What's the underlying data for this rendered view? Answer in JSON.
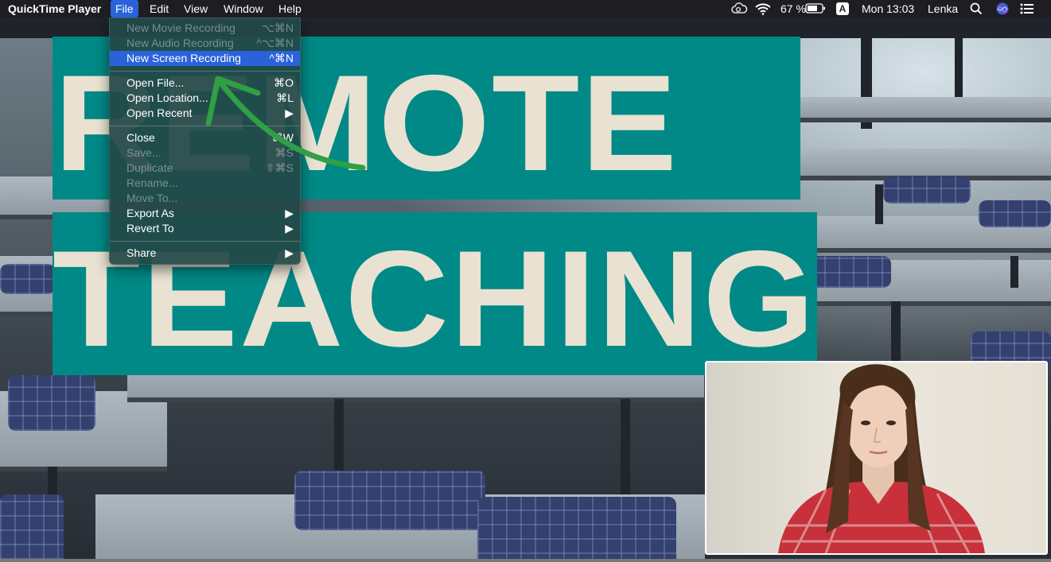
{
  "menubar": {
    "app_name": "QuickTime Player",
    "items": [
      "File",
      "Edit",
      "View",
      "Window",
      "Help"
    ],
    "battery": "67 %",
    "input_source": "A",
    "clock": "Mon 13:03",
    "user": "Lenka"
  },
  "file_menu": {
    "items": [
      {
        "label": "New Movie Recording",
        "shortcut": "⌥⌘N",
        "enabled": false
      },
      {
        "label": "New Audio Recording",
        "shortcut": "^⌥⌘N",
        "enabled": false
      },
      {
        "label": "New Screen Recording",
        "shortcut": "^⌘N",
        "enabled": true,
        "highlighted": true
      },
      {
        "label": "Open File...",
        "shortcut": "⌘O",
        "enabled": true
      },
      {
        "label": "Open Location...",
        "shortcut": "⌘L",
        "enabled": true
      },
      {
        "label": "Open Recent",
        "shortcut": "▶",
        "enabled": true
      },
      {
        "label": "Close",
        "shortcut": "⌘W",
        "enabled": true
      },
      {
        "label": "Save...",
        "shortcut": "⌘S",
        "enabled": false
      },
      {
        "label": "Duplicate",
        "shortcut": "⇧⌘S",
        "enabled": false
      },
      {
        "label": "Rename...",
        "shortcut": "",
        "enabled": false
      },
      {
        "label": "Move To...",
        "shortcut": "",
        "enabled": false
      },
      {
        "label": "Export As",
        "shortcut": "▶",
        "enabled": true
      },
      {
        "label": "Revert To",
        "shortcut": "▶",
        "enabled": true
      },
      {
        "label": "Share",
        "shortcut": "▶",
        "enabled": true
      }
    ]
  },
  "banner": {
    "line1": "REMOTE",
    "line2": "TEACHING"
  },
  "colors": {
    "banner_bg": "#008986",
    "banner_text": "#e9e2d2",
    "menu_highlight": "#2a63d9",
    "arrow": "#2fa043"
  },
  "icons": {
    "creative_cloud": "creative-cloud-icon",
    "wifi": "wifi-icon",
    "battery": "battery-icon",
    "search": "search-icon",
    "siri": "siri-icon",
    "notification_center": "notification-center-icon"
  }
}
